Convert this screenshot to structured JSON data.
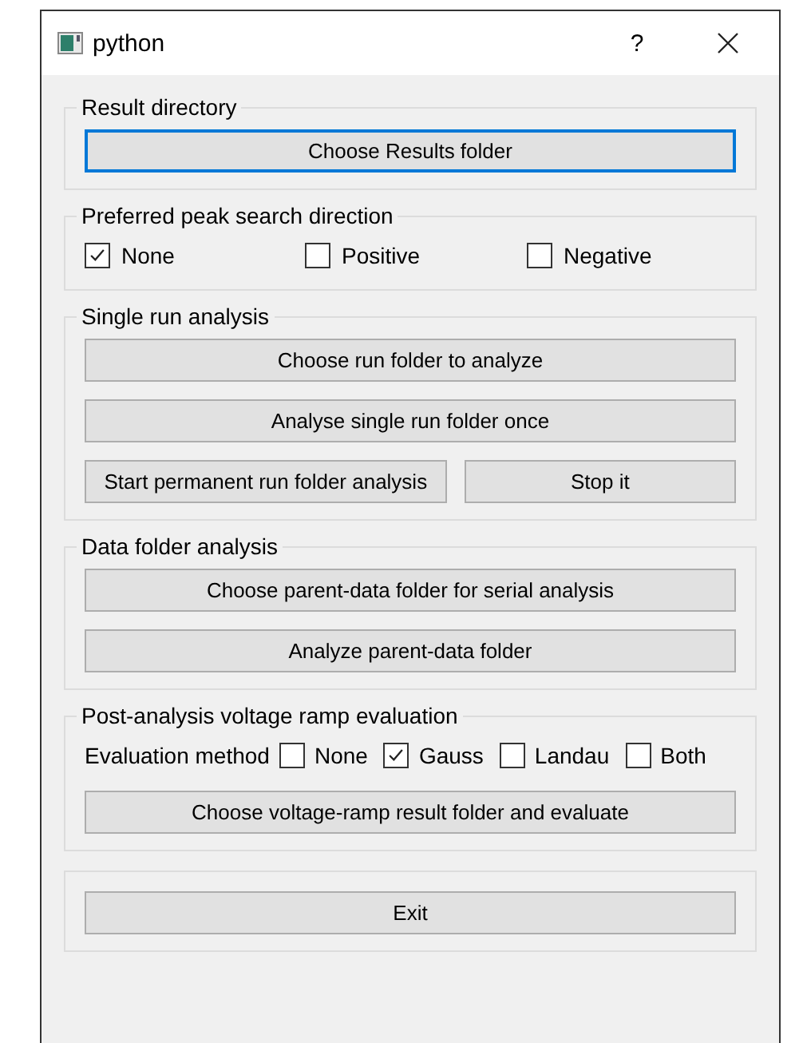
{
  "window": {
    "title": "python",
    "help": "?"
  },
  "groups": [
    {
      "title": "Result directory",
      "rows": [
        {
          "kind": "buttons",
          "buttons": [
            {
              "label": "Choose Results folder",
              "focused": true
            }
          ]
        }
      ]
    },
    {
      "title": "Preferred peak search direction",
      "rows": [
        {
          "kind": "checkboxes",
          "options": [
            {
              "label": "None",
              "checked": true
            },
            {
              "label": "Positive",
              "checked": false
            },
            {
              "label": "Negative",
              "checked": false
            }
          ]
        }
      ]
    },
    {
      "title": "Single run analysis",
      "rows": [
        {
          "kind": "buttons",
          "buttons": [
            {
              "label": "Choose run folder to analyze",
              "focused": false
            }
          ]
        },
        {
          "kind": "buttons",
          "buttons": [
            {
              "label": "Analyse single run folder once",
              "focused": false
            }
          ]
        },
        {
          "kind": "buttons",
          "buttons": [
            {
              "label": "Start permanent run folder analysis",
              "focused": false
            },
            {
              "label": "Stop it",
              "focused": false
            }
          ]
        }
      ]
    },
    {
      "title": "Data folder analysis",
      "rows": [
        {
          "kind": "buttons",
          "buttons": [
            {
              "label": "Choose parent-data folder for serial analysis",
              "focused": false
            }
          ]
        },
        {
          "kind": "buttons",
          "buttons": [
            {
              "label": "Analyze parent-data folder",
              "focused": false
            }
          ]
        }
      ]
    },
    {
      "title": "Post-analysis voltage ramp evaluation",
      "rows": [
        {
          "kind": "labeled-checkboxes",
          "label": "Evaluation method",
          "options": [
            {
              "label": "None",
              "checked": false
            },
            {
              "label": "Gauss",
              "checked": true
            },
            {
              "label": "Landau",
              "checked": false
            },
            {
              "label": "Both",
              "checked": false
            }
          ]
        },
        {
          "kind": "buttons",
          "buttons": [
            {
              "label": "Choose voltage-ramp result folder and evaluate",
              "focused": false
            }
          ]
        }
      ]
    },
    {
      "rows": [
        {
          "kind": "buttons",
          "buttons": [
            {
              "label": "Exit",
              "focused": false
            }
          ]
        }
      ]
    }
  ]
}
